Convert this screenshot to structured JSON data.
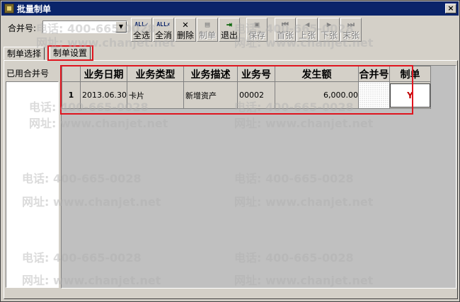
{
  "window": {
    "title": "批量制单",
    "close": "×"
  },
  "toolbar": {
    "merge_label": "合并号:",
    "merge_value": "",
    "buttons": [
      {
        "label": "全选",
        "icon": "ALL✓",
        "enabled": true
      },
      {
        "label": "全消",
        "icon": "ALL✗",
        "enabled": true
      },
      {
        "label": "删除",
        "icon": "✕",
        "enabled": true
      },
      {
        "label": "制单",
        "icon": "▤",
        "enabled": false
      },
      {
        "label": "退出",
        "icon": "⇥",
        "enabled": true
      },
      {
        "label": "保存",
        "icon": "▣",
        "enabled": false
      },
      {
        "label": "首张",
        "icon": "⏮",
        "enabled": false
      },
      {
        "label": "上张",
        "icon": "◀",
        "enabled": false
      },
      {
        "label": "下张",
        "icon": "▶",
        "enabled": false
      },
      {
        "label": "末张",
        "icon": "⏭",
        "enabled": false
      }
    ]
  },
  "tabs": [
    {
      "label": "制单选择"
    },
    {
      "label": "制单设置"
    }
  ],
  "panel": {
    "used_merge_label": "已用合并号"
  },
  "table": {
    "headers": [
      "",
      "业务日期",
      "业务类型",
      "业务描述",
      "业务号",
      "发生额",
      "合并号",
      "制单"
    ],
    "rows": [
      {
        "index": "1",
        "date": "2013.06.30",
        "type": "卡片",
        "desc": "新增资产",
        "no": "00002",
        "amount": "6,000.00",
        "merge": "",
        "flag": "Y"
      }
    ]
  },
  "watermark": {
    "phone": "电话: 400-665-0028",
    "site": "网址: www.chanjet.net"
  },
  "colors": {
    "highlight": "#e0141e",
    "titlebar": "#0a246a",
    "flag": "#c00000"
  }
}
